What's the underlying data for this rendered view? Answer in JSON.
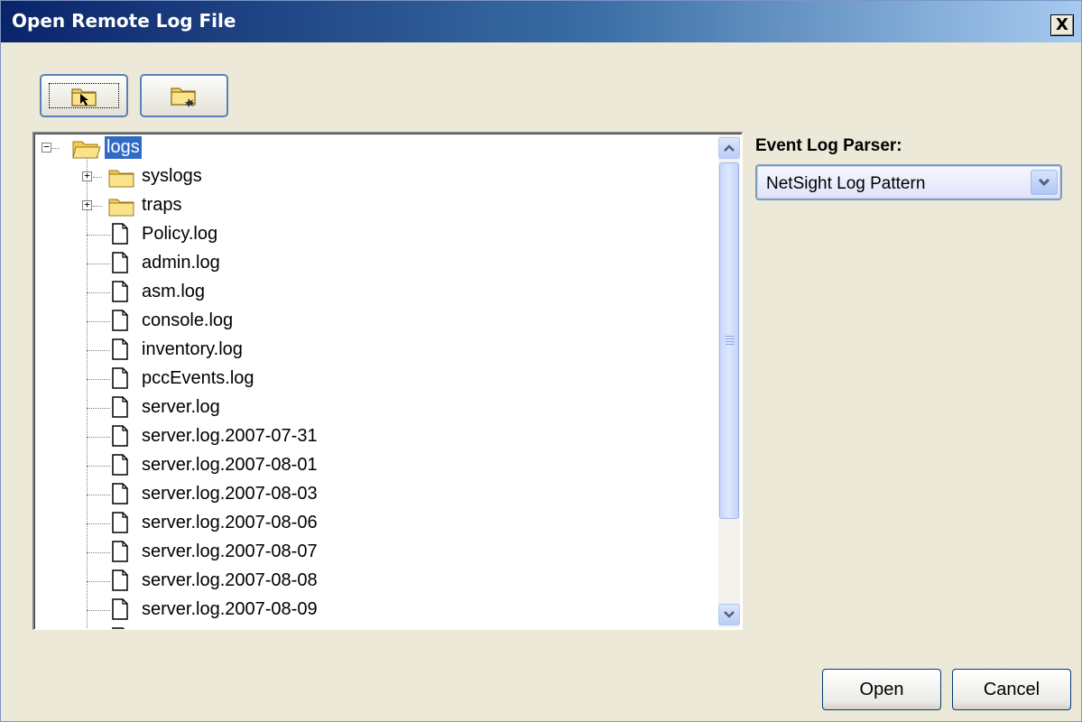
{
  "window": {
    "title": "Open Remote Log File",
    "close_glyph": "X"
  },
  "toolbar": [
    {
      "name": "open-folder-button",
      "icon": "folder-pointer-icon"
    },
    {
      "name": "new-folder-button",
      "icon": "folder-new-icon"
    }
  ],
  "tree": {
    "root": {
      "label": "logs",
      "expanded": true,
      "selected": true
    },
    "folders": [
      {
        "label": "syslogs",
        "expanded": false
      },
      {
        "label": "traps",
        "expanded": false
      }
    ],
    "files": [
      "Policy.log",
      "admin.log",
      "asm.log",
      "console.log",
      "inventory.log",
      "pccEvents.log",
      "server.log",
      "server.log.2007-07-31",
      "server.log.2007-08-01",
      "server.log.2007-08-03",
      "server.log.2007-08-06",
      "server.log.2007-08-07",
      "server.log.2007-08-08",
      "server.log.2007-08-09"
    ]
  },
  "parser": {
    "label": "Event Log Parser:",
    "selected": "NetSight Log Pattern"
  },
  "buttons": {
    "open": "Open",
    "cancel": "Cancel"
  },
  "colors": {
    "title_start": "#0a246a",
    "title_end": "#a6caf0",
    "selection": "#316ac5",
    "dialog_bg": "#ece9d8"
  }
}
